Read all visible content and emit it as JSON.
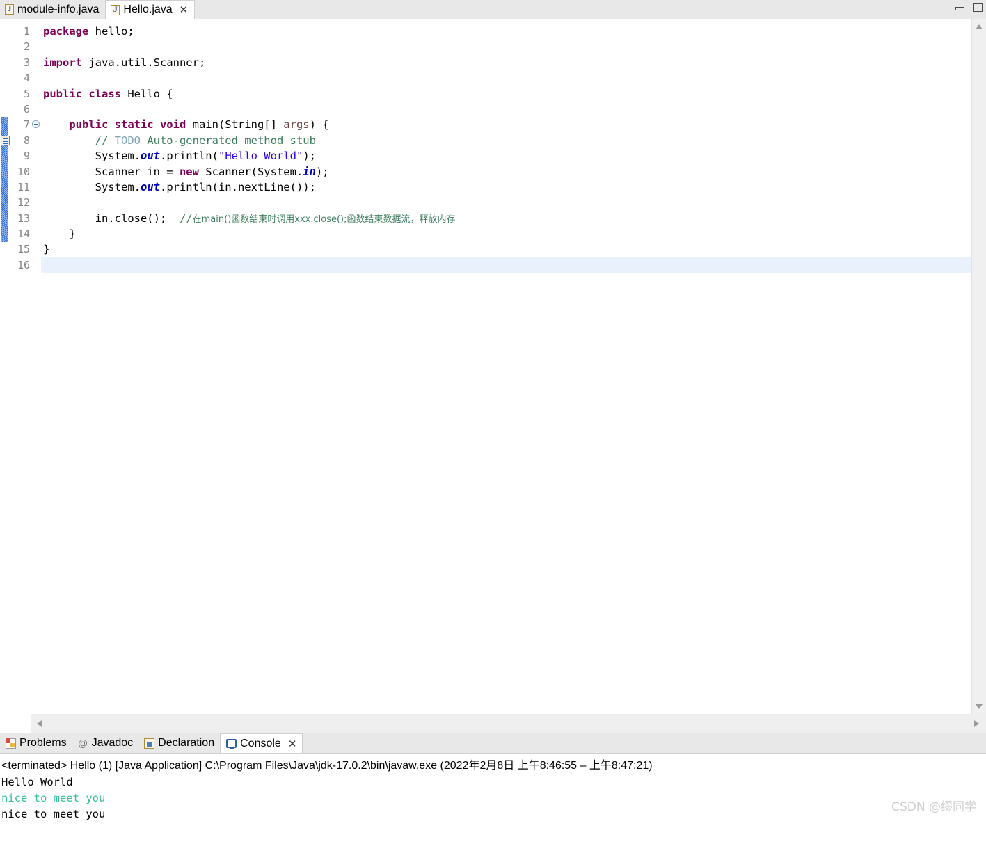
{
  "window": {
    "minimize_label": "minimize",
    "maximize_label": "maximize"
  },
  "editor_tabs": [
    {
      "label": "module-info.java",
      "icon": "java-file-icon",
      "active": false,
      "closable": false
    },
    {
      "label": "Hello.java",
      "icon": "java-file-icon",
      "active": true,
      "closable": true,
      "close_glyph": "✕"
    }
  ],
  "editor": {
    "line_numbers": [
      "1",
      "2",
      "3",
      "4",
      "5",
      "6",
      "7",
      "8",
      "9",
      "10",
      "11",
      "12",
      "13",
      "14",
      "15",
      "16"
    ],
    "fold_marker_glyph": "⊖",
    "fold_marker_line": 7,
    "current_line": 16,
    "lines": [
      {
        "n": 1,
        "tokens": [
          {
            "t": "kw",
            "v": "package"
          },
          {
            "t": "plain",
            "v": " hello;"
          }
        ]
      },
      {
        "n": 2,
        "tokens": []
      },
      {
        "n": 3,
        "tokens": [
          {
            "t": "kw",
            "v": "import"
          },
          {
            "t": "plain",
            "v": " java.util.Scanner;"
          }
        ]
      },
      {
        "n": 4,
        "tokens": []
      },
      {
        "n": 5,
        "tokens": [
          {
            "t": "kw",
            "v": "public class"
          },
          {
            "t": "plain",
            "v": " Hello {"
          }
        ]
      },
      {
        "n": 6,
        "tokens": []
      },
      {
        "n": 7,
        "tokens": [
          {
            "t": "plain",
            "v": "    "
          },
          {
            "t": "kw",
            "v": "public static void"
          },
          {
            "t": "plain",
            "v": " main(String[] "
          },
          {
            "t": "param",
            "v": "args"
          },
          {
            "t": "plain",
            "v": ") {"
          }
        ]
      },
      {
        "n": 8,
        "tokens": [
          {
            "t": "plain",
            "v": "        "
          },
          {
            "t": "cmt",
            "v": "// "
          },
          {
            "t": "todo",
            "v": "TODO"
          },
          {
            "t": "cmt",
            "v": " Auto-generated method stub"
          }
        ]
      },
      {
        "n": 9,
        "tokens": [
          {
            "t": "plain",
            "v": "        System."
          },
          {
            "t": "fld",
            "v": "out"
          },
          {
            "t": "plain",
            "v": ".println("
          },
          {
            "t": "str",
            "v": "\"Hello World\""
          },
          {
            "t": "plain",
            "v": ");"
          }
        ]
      },
      {
        "n": 10,
        "tokens": [
          {
            "t": "plain",
            "v": "        Scanner in = "
          },
          {
            "t": "kw",
            "v": "new"
          },
          {
            "t": "plain",
            "v": " Scanner(System."
          },
          {
            "t": "fld",
            "v": "in"
          },
          {
            "t": "plain",
            "v": ");"
          }
        ]
      },
      {
        "n": 11,
        "tokens": [
          {
            "t": "plain",
            "v": "        System."
          },
          {
            "t": "fld",
            "v": "out"
          },
          {
            "t": "plain",
            "v": ".println(in.nextLine());"
          }
        ]
      },
      {
        "n": 12,
        "tokens": []
      },
      {
        "n": 13,
        "tokens": [
          {
            "t": "plain",
            "v": "        in.close();  "
          },
          {
            "t": "cmt",
            "v": "//"
          },
          {
            "t": "cmt-cn",
            "v": "在main()函数结束时调用xxx.close();函数结束数据流，释放内存"
          }
        ]
      },
      {
        "n": 14,
        "tokens": [
          {
            "t": "plain",
            "v": "    }"
          }
        ]
      },
      {
        "n": 15,
        "tokens": [
          {
            "t": "plain",
            "v": "}"
          }
        ]
      },
      {
        "n": 16,
        "tokens": []
      }
    ],
    "change_bar_from_line": 7,
    "change_bar_to_line": 14,
    "todo_marker_line": 8
  },
  "scrollbars": {
    "vertical_up_glyph": "▲",
    "vertical_down_glyph": "▼",
    "horizontal_left_glyph": "◀",
    "horizontal_right_glyph": "▶"
  },
  "view_tabs": [
    {
      "label": "Problems",
      "icon": "problems-icon",
      "active": false,
      "closable": false
    },
    {
      "label": "Javadoc",
      "icon": "javadoc-icon",
      "active": false,
      "closable": false,
      "glyph": "@"
    },
    {
      "label": "Declaration",
      "icon": "declaration-icon",
      "active": false,
      "closable": false
    },
    {
      "label": "Console",
      "icon": "console-icon",
      "active": true,
      "closable": true,
      "close_glyph": "✕"
    }
  ],
  "console": {
    "header": "<terminated> Hello (1) [Java Application] C:\\Program Files\\Java\\jdk-17.0.2\\bin\\javaw.exe  (2022年2月8日 上午8:46:55 – 上午8:47:21)",
    "output": [
      {
        "text": "Hello World",
        "stream": "stdout"
      },
      {
        "text": "nice to meet you",
        "stream": "stdin"
      },
      {
        "text": "nice to meet you",
        "stream": "stdout"
      }
    ]
  },
  "watermark": "CSDN @缪同学",
  "colors": {
    "keyword": "#7f0055",
    "string": "#2a00ff",
    "comment": "#3f7f5f",
    "todo": "#7fa5b8",
    "static_field": "#0000c0",
    "parameter": "#6a3e3e",
    "change_bar": "#2b6cd4",
    "current_line": "#e8f1fc",
    "stdin": "#30c296",
    "tab_bar": "#e8e8e8"
  }
}
